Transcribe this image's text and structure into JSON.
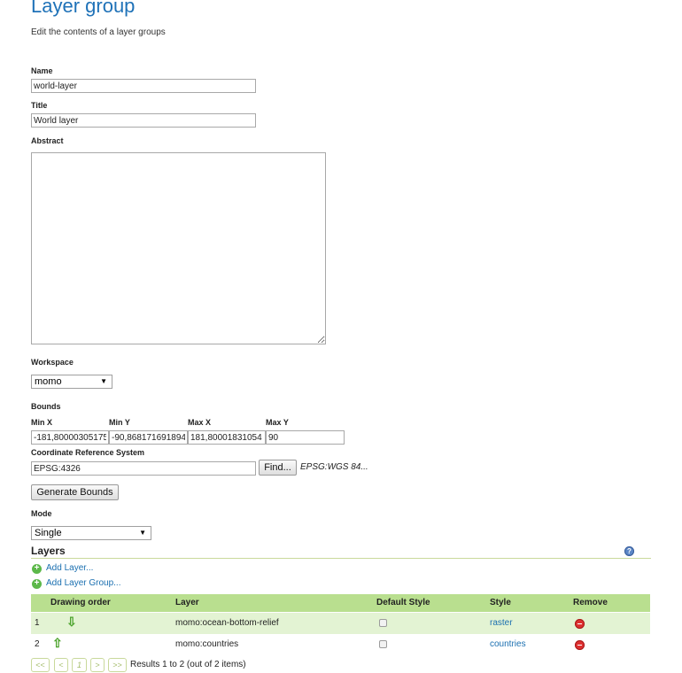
{
  "header": {
    "title": "Layer group",
    "subtitle": "Edit the contents of a layer groups"
  },
  "form": {
    "name_label": "Name",
    "name_value": "world-layer",
    "title_label": "Title",
    "title_value": "World layer",
    "abstract_label": "Abstract",
    "abstract_value": "",
    "workspace_label": "Workspace",
    "workspace_value": "momo",
    "bounds_label": "Bounds",
    "bounds": {
      "minx_label": "Min X",
      "minx_value": "-181,80000305175",
      "miny_label": "Min Y",
      "miny_value": "-90,868171691894",
      "maxx_label": "Max X",
      "maxx_value": "181,80001831054",
      "maxy_label": "Max Y",
      "maxy_value": "90"
    },
    "crs_label": "Coordinate Reference System",
    "crs_value": "EPSG:4326",
    "find_button": "Find...",
    "crs_name": "EPSG:WGS 84...",
    "generate_bounds_button": "Generate Bounds",
    "mode_label": "Mode",
    "mode_value": "Single"
  },
  "layers": {
    "title": "Layers",
    "add_layer": "Add Layer...",
    "add_layer_group": "Add Layer Group...",
    "columns": [
      "Drawing order",
      "Layer",
      "Default Style",
      "Style",
      "Remove"
    ],
    "rows": [
      {
        "order": "1",
        "layer": "momo:ocean-bottom-relief",
        "style": "raster",
        "default_style": false,
        "move_icon": "arrow-down-icon"
      },
      {
        "order": "2",
        "layer": "momo:countries",
        "style": "countries",
        "default_style": false,
        "move_icon": "arrow-up-icon"
      }
    ]
  },
  "pager": {
    "first": "<<",
    "prev": "<",
    "page": "1",
    "next": ">",
    "last": ">>",
    "results": "Results 1 to 2 (out of 2 items)"
  },
  "colors": {
    "title_blue": "#1f72b8",
    "table_header": "#b9df8f",
    "row_highlight": "#e3f3d3",
    "link": "#1a6fb0"
  }
}
